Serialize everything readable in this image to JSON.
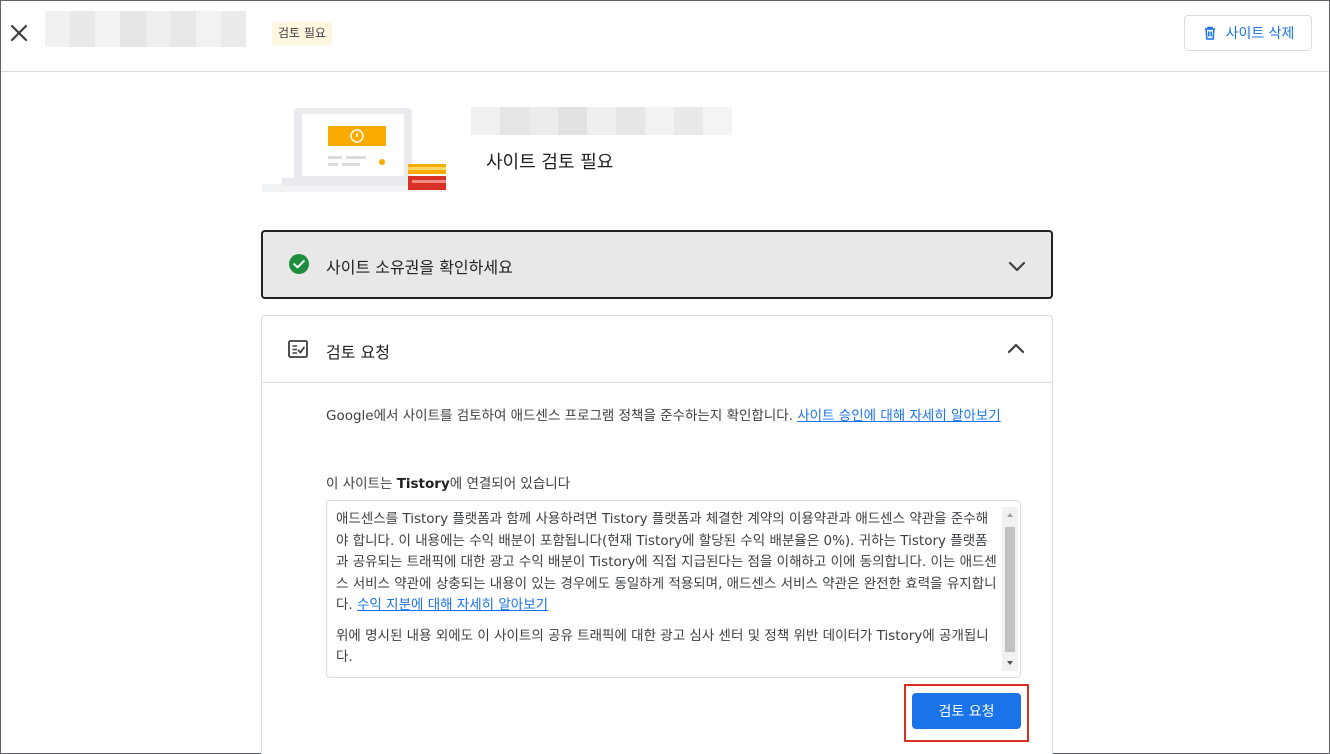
{
  "header": {
    "close_icon": "close-icon",
    "status_chip": "검토 필요",
    "delete_button": {
      "label": "사이트 삭제",
      "icon": "trash-icon"
    }
  },
  "hero": {
    "title": "사이트 검토 필요",
    "illustration": "laptop-warning-illustration"
  },
  "ownership_step": {
    "label": "사이트 소유권을 확인하세요",
    "status_icon": "check-circle-icon",
    "status_color": "#1e8e3e",
    "expanded": false
  },
  "review_step": {
    "label": "검토 요청",
    "icon": "review-checklist-icon",
    "expanded": true,
    "intro_text": "Google에서 사이트를 검토하여 애드센스 프로그램 정책을 준수하는지 확인합니다. ",
    "intro_link": "사이트 승인에 대해 자세히 알아보기",
    "connected_prefix": "이 사이트는 ",
    "connected_platform": "Tistory",
    "connected_suffix": "에 연결되어 있습니다",
    "terms_paragraph1": "애드센스를 Tistory 플랫폼과 함께 사용하려면 Tistory 플랫폼과 체결한 계약의 이용약관과 애드센스 약관을 준수해야 합니다. 이 내용에는 수익 배분이 포함됩니다(현재 Tistory에 할당된 수익 배분율은 0%). 귀하는 Tistory 플랫폼과 공유되는 트래픽에 대한 광고 수익 배분이 Tistory에 직접 지급된다는 점을 이해하고 이에 동의합니다. 이는 애드센스 서비스 약관에 상충되는 내용이 있는 경우에도 동일하게 적용되며, 애드센스 서비스 약관은 완전한 효력을 유지합니다. ",
    "terms_link": "수익 지분에 대해 자세히 알아보기",
    "terms_paragraph2": "위에 명시된 내용 외에도 이 사이트의 공유 트래픽에 대한 광고 심사 센터 및 정책 위반 데이터가 Tistory에 공개됩니다.",
    "submit_button": "검토 요청"
  },
  "colors": {
    "accent": "#1a73e8",
    "chip_bg": "#fef7e0",
    "highlight": "#d93025",
    "illustration_yellow": "#f9ab00",
    "illustration_red": "#d93025"
  }
}
